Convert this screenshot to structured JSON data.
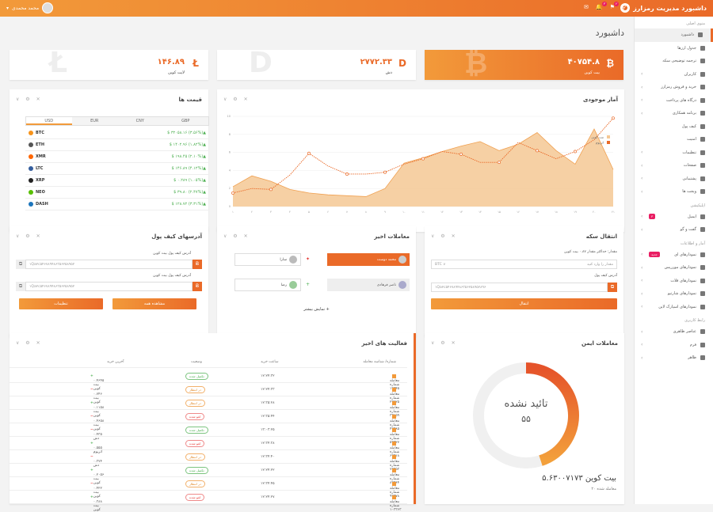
{
  "header": {
    "brand": "داشبورد مدیریت رمزارز",
    "user": "محمد محمدی",
    "badge1": "۳",
    "badge2": "۲"
  },
  "page_title": "داشبورد",
  "stats": [
    {
      "value": "۴۰۷۵۴.۸",
      "name": "بیت کوین",
      "symbol": "₿"
    },
    {
      "value": "۲۷۷۲.۳۳",
      "name": "دش",
      "symbol": "D"
    },
    {
      "value": "۱۴۶.۸۹",
      "name": "لایت کوین",
      "symbol": "Ł"
    }
  ],
  "prices": {
    "title": "قیمت ها",
    "tabs": [
      "USD",
      "EUR",
      "CNY",
      "GBP"
    ],
    "rows": [
      {
        "coin": "BTC",
        "price": "$ ۳۲۰۵۸.۱۶ (۳.۵۶%)▲"
      },
      {
        "coin": "ETH",
        "price": "$ ۱۴۰۲.۹۶ (۱.۸۲%)▲"
      },
      {
        "coin": "XMR",
        "price": "$ ۱۹۸.۴۵ (۲.۱۰%)▲"
      },
      {
        "coin": "LTC",
        "price": "$ ۱۴۶.۸۹ (۴.۱۲%)▲"
      },
      {
        "coin": "XRP",
        "price": "$ ۰.۲۸۹ (۱.۰۵%)▲"
      },
      {
        "coin": "NEO",
        "price": "$ ۳۹.۸۰ (۲.۴۷%)▲"
      },
      {
        "coin": "DASH",
        "price": "$ ۱۲۸.۷۲ (۳.۳۱%)▲"
      }
    ]
  },
  "chart": {
    "title": "آمار موجودی",
    "legend": [
      "بیت کوین",
      "اتریوم"
    ]
  },
  "chart_data": {
    "type": "area",
    "categories": [
      "۱",
      "۲",
      "۳",
      "۴",
      "۵",
      "۶",
      "۷",
      "۸",
      "۹",
      "۱۰",
      "۱۱",
      "۱۲",
      "۱۳",
      "۱۴",
      "۱۵",
      "۱۶",
      "۱۷",
      "۱۸",
      "۱۹",
      "۲۰",
      "۲۱"
    ],
    "ylim": [
      0,
      10
    ],
    "series": [
      {
        "name": "بیت کوین",
        "values": [
          2.2,
          3.4,
          2.8,
          1.9,
          1.5,
          1.3,
          1.2,
          1.1,
          2.0,
          4.8,
          5.4,
          6.1,
          6.7,
          7.2,
          6.2,
          6.9,
          8.2,
          6.2,
          4.7,
          8.6,
          4.1
        ]
      },
      {
        "name": "اتریوم",
        "values": [
          1.5,
          2.0,
          1.9,
          3.5,
          5.9,
          4.5,
          3.6,
          3.6,
          3.8,
          4.7,
          5.3,
          6.1,
          5.8,
          4.9,
          4.9,
          7.1,
          6.2,
          5.3,
          6.1,
          7.4,
          9.8
        ]
      }
    ],
    "area_series": 0,
    "line_series": 1
  },
  "transfer": {
    "title": "انتقال سکه",
    "amount_label": "مقدار: حداکثر مقدار ۰.۸۷ بیت کوین",
    "amount_ph": "مقدار را وارد کنید",
    "unit": "BTC ∨",
    "addr_label": "آدرس کیف پول",
    "addr_value": "۱Qa۲c۵۴۶۷۸۹۴۸۶۳۵۶۲۵۸۹۵۲۸۹۶",
    "button": "انتقال"
  },
  "trades": {
    "title": "معاملات اخیر",
    "buyer1": "محمد دوست",
    "seller1": "سارا",
    "buyer2": "ناصر فرهادی",
    "seller2": "رضا",
    "more": "نمایش بیشتر +"
  },
  "wallet": {
    "title": "آدرسهای کیف پول",
    "label1": "آدرس کیف پول بیت کوین",
    "addr1": "۱Qa۲c۵۴۶۷۸۹۴۸۶۳۵۶۲۵۸۹۵۲",
    "label2": "آدرس کیف پول بیت کوین",
    "addr2": "۱Qa۲c۵۴۶۷۸۹۴۸۶۳۵۶۲۵۸۹۵۲",
    "btn1": "مشاهده همه",
    "btn2": "تنظیمات"
  },
  "activity": {
    "title": "فعالیت های اخیر",
    "cols": [
      "شماره/ شناسه معامله",
      "ساعت خرید",
      "وضعیت",
      "آخرین خرید"
    ],
    "rows": [
      {
        "id": "معامله شماره ۱۳۳۴۵",
        "time": "۱۲:۲۴:۳۲",
        "status": "تکمیل شده",
        "s": "g",
        "amount": "۰.۴۶۴۵ بیت کوین",
        "d": "up"
      },
      {
        "id": "معامله شماره ۲۳۲۲۵",
        "time": "۱۲:۲۴:۳۳",
        "status": "در انتظار",
        "s": "o",
        "amount": "۰.۷۴۶ بیت کوین",
        "d": "down"
      },
      {
        "id": "معامله شماره ۳۳۶۵۹",
        "time": "۱۲:۳۵:۲۸",
        "status": "در انتظار",
        "s": "o",
        "amount": "۰.۱۱۵۸ بیت کوین",
        "d": "up"
      },
      {
        "id": "معامله شماره ۴۳۳۸۵",
        "time": "۱۲:۳۵:۴۴",
        "status": "لغو شده",
        "s": "r",
        "amount": "۰.۴۶۵۸ بیت کوین",
        "d": "down"
      },
      {
        "id": "معامله شماره ۵۳۳۲۷",
        "time": "۱۳:۰۳:۲۵",
        "status": "تکمیل شده",
        "s": "g",
        "amount": "۰.۴۳۵ دش",
        "d": "down"
      },
      {
        "id": "معامله شماره ۶۳۳۱۸",
        "time": "۱۲:۳۴:۳۸",
        "status": "لغو شده",
        "s": "r",
        "amount": "۰.۵۵۵ اتریوم",
        "d": "up"
      },
      {
        "id": "معامله شماره ۷۳۳۵۳",
        "time": "۱۲:۳۴:۴۰",
        "status": "در انتظار",
        "s": "o",
        "amount": "۰.۳۷۴ دش",
        "d": "down"
      },
      {
        "id": "معامله شماره ۸۳۳۶۴",
        "time": "۱۲:۲۴:۲۲",
        "status": "تکمیل شده",
        "s": "g",
        "amount": "۰.۲۰۵۶ بیت کوین",
        "d": "up"
      },
      {
        "id": "معامله شماره ۹۳۳۷۸",
        "time": "۱۲:۳۴:۴۵",
        "status": "در انتظار",
        "s": "o",
        "amount": "۰.۴۲۲ بیت کوین",
        "d": "down"
      },
      {
        "id": "معامله شماره ۱۰۳۳۶۳",
        "time": "۱۲:۲۴:۲۷",
        "status": "لغو شده",
        "s": "r",
        "amount": "۰.۳۸۸ بیت کوین",
        "d": "up"
      }
    ]
  },
  "secure": {
    "title": "معاملات ایمن",
    "center": "تائید نشده",
    "count": "۵۵",
    "confirmed_fraction": 0.45,
    "total": "۵.۶۳۰۰۷۱۷۳ بیت کوین",
    "sub": "۲۰ معامله شده"
  },
  "sidebar": {
    "sec1": "منوی اصلی",
    "items1": [
      "داشبورد",
      "جدول ارزها",
      "ترجمه توضیحی سکه",
      "کاربران",
      "خرید و فروش رمزارز",
      "درگاه های پرداخت",
      "برنامه همکاری",
      "کیف پول",
      "امنیت",
      "تنظیمات",
      "صفحات",
      "پشتیبانی",
      "ویجت ها"
    ],
    "sec2": "اپلیکیشن",
    "items2": [
      "ایمیل",
      "گفت و گو"
    ],
    "tag": "جدید",
    "sec3": "آمار و اطلاعات",
    "items3": [
      "نمودارهای ای",
      "نمودارهای مورریس",
      "نمودارهای فلات",
      "نمودارهای شارتیو",
      "نمودارهای اسپارک لاین"
    ],
    "sec4": "رابط کاربری",
    "items4": [
      "عناصر ظاهری",
      "فرم",
      "ظاهر"
    ]
  }
}
